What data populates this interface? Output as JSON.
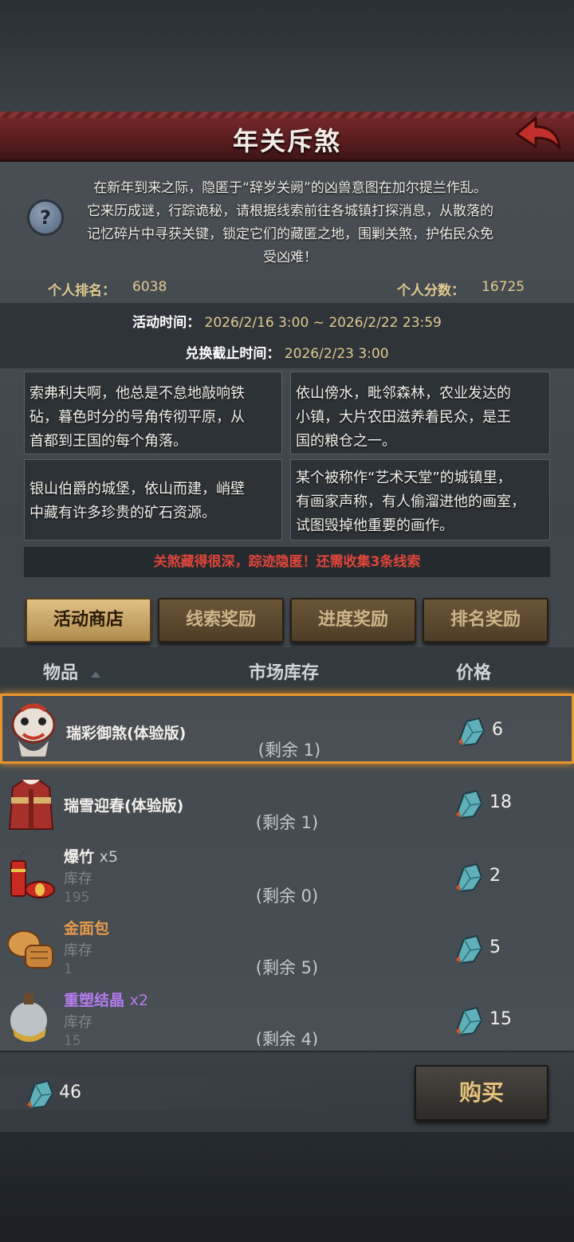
{
  "header": {
    "title": "年关斥煞"
  },
  "intro": {
    "lines": [
      "在新年到来之际，隐匿于“辞岁关阙”的凶兽意图在加尔提兰作乱。",
      "它来历成谜，行踪诡秘，请根据线索前往各城镇打探消息，从散落的",
      "记忆碎片中寻获关键，锁定它们的藏匿之地，围剿关煞，护佑民众免",
      "受凶难！"
    ]
  },
  "stats": {
    "rank_label": "个人排名：",
    "rank_value": "6038",
    "score_label": "个人分数：",
    "score_value": "16725"
  },
  "times": {
    "activity_label": "活动时间：",
    "activity_value": "2026/2/16 3:00 ~ 2026/2/22 23:59",
    "exchange_label": "兑换截止时间：",
    "exchange_value": "2026/2/23 3:00"
  },
  "clues": [
    {
      "lines": [
        "索弗利夫啊，他总是不怠地敲响铁",
        "砧，暮色时分的号角传彻平原，从",
        "首都到王国的每个角落。"
      ]
    },
    {
      "lines": [
        "依山傍水，毗邻森林，农业发达的",
        "小镇，大片农田滋养着民众，是王",
        "国的粮仓之一。"
      ]
    },
    {
      "lines": [
        "银山伯爵的城堡，依山而建，峭壁",
        "中藏有许多珍贵的矿石资源。"
      ]
    },
    {
      "lines": [
        "某个被称作“艺术天堂”的城镇里，",
        "有画家声称，有人偷溜进他的画室，",
        "试图毁掉他重要的画作。"
      ]
    }
  ],
  "clue_status": "关煞藏得很深，踪迹隐匿！还需收集3条线索",
  "tabs": [
    {
      "label": "活动商店",
      "active": true
    },
    {
      "label": "线索奖励",
      "active": false
    },
    {
      "label": "进度奖励",
      "active": false
    },
    {
      "label": "排名奖励",
      "active": false
    }
  ],
  "table": {
    "headers": {
      "item": "物品",
      "stock": "市场库存",
      "price": "价格"
    },
    "rows": [
      {
        "name": "瑞彩御煞(体验版)",
        "mult": "",
        "stock_label": "",
        "stock_value": "",
        "remain": "(剩余 1)",
        "price": "6",
        "name_color": "#f2f0ea",
        "selected": true
      },
      {
        "name": "瑞雪迎春(体验版)",
        "mult": "",
        "stock_label": "",
        "stock_value": "",
        "remain": "(剩余 1)",
        "price": "18",
        "name_color": "#f2f0ea",
        "selected": false
      },
      {
        "name": "爆竹",
        "mult": "x5",
        "stock_label": "库存",
        "stock_value": "195",
        "remain": "(剩余 0)",
        "price": "2",
        "name_color": "#f2f0ea",
        "selected": false
      },
      {
        "name": "金面包",
        "mult": "",
        "stock_label": "库存",
        "stock_value": "1",
        "remain": "(剩余 5)",
        "price": "5",
        "name_color": "#e79a4a",
        "selected": false
      },
      {
        "name": "重塑结晶",
        "mult": "x2",
        "stock_label": "库存",
        "stock_value": "15",
        "remain": "(剩余 4)",
        "price": "15",
        "name_color": "#b57cf0",
        "selected": false
      }
    ]
  },
  "footer": {
    "currency_value": "46",
    "buy_label": "购买"
  },
  "icons": {
    "back": "back-arrow-icon",
    "help": "question-icon",
    "currency": "crystal-shard-icon"
  },
  "colors": {
    "accent_gold": "#e2c98e",
    "selection_orange": "#e8952a",
    "alert_red": "#e0453a",
    "title_red": "#5a1d1f"
  }
}
